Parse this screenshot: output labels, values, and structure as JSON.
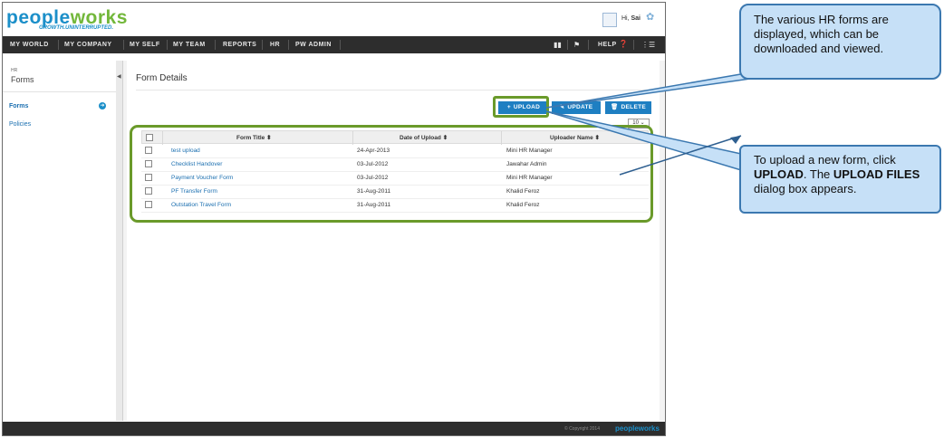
{
  "app": {
    "logo_main": "peo",
    "logo_o": "ple",
    "logo_tail": "works",
    "tagline": "GROWTH.UNINTERRUPTED.",
    "greeting": "Hi, ",
    "user_name": "Sai"
  },
  "nav": {
    "items": [
      "MY WORLD",
      "MY COMPANY",
      "MY SELF",
      "MY TEAM",
      "REPORTS",
      "HR",
      "PW ADMIN"
    ],
    "help": "HELP"
  },
  "sidebar": {
    "section": "HR",
    "title": "Forms",
    "items": [
      "Forms",
      "Policies"
    ]
  },
  "main": {
    "title": "Form Details",
    "buttons": {
      "upload": "UPLOAD",
      "update": "UPDATE",
      "delete": "DELETE"
    },
    "page_size": "10",
    "columns": [
      "Form Title",
      "Date of Upload",
      "Uploader Name"
    ],
    "rows": [
      {
        "title": "test upload",
        "date": "24-Apr-2013",
        "uploader": "Mini HR Manager"
      },
      {
        "title": "Checklist Handover",
        "date": "03-Jul-2012",
        "uploader": "Jawahar Admin"
      },
      {
        "title": "Payment Voucher Form",
        "date": "03-Jul-2012",
        "uploader": "Mini HR Manager"
      },
      {
        "title": "PF Transfer Form",
        "date": "31-Aug-2011",
        "uploader": "Khalid Feroz"
      },
      {
        "title": "Outstation Travel Form",
        "date": "31-Aug-2011",
        "uploader": "Khalid Feroz"
      }
    ]
  },
  "footer": {
    "copyright": "© Copyright 2014",
    "logo": "peopleworks"
  },
  "callouts": {
    "top": "The various HR forms are displayed, which can be downloaded and viewed.",
    "bottom_pre": "To upload a new form, click ",
    "bottom_b1": "UPLOAD",
    "bottom_mid": ". The ",
    "bottom_b2": "UPLOAD FILES",
    "bottom_post": " dialog box appears."
  },
  "colors": {
    "brand_blue": "#1b8fc9",
    "brand_green": "#72b73a",
    "button_blue": "#1e7fc2",
    "highlight_green": "#6a9a2a",
    "callout_fill": "#c6e0f7"
  }
}
